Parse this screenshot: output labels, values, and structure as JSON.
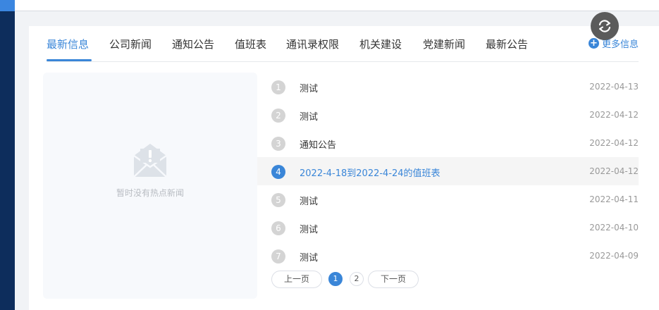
{
  "tabs": [
    {
      "label": "最新信息",
      "active": true
    },
    {
      "label": "公司新闻"
    },
    {
      "label": "通知公告"
    },
    {
      "label": "值班表"
    },
    {
      "label": "通讯录权限"
    },
    {
      "label": "机关建设"
    },
    {
      "label": "党建新闻"
    },
    {
      "label": "最新公告"
    }
  ],
  "more": {
    "icon": "plus-circle-icon",
    "label": "更多信息"
  },
  "refresh": {
    "icon": "refresh-icon"
  },
  "hot_news": {
    "icon": "empty-mail-icon",
    "empty_text": "暂时没有热点新闻"
  },
  "news": [
    {
      "num": "1",
      "title": "测试",
      "date": "2022-04-13"
    },
    {
      "num": "2",
      "title": "测试",
      "date": "2022-04-12"
    },
    {
      "num": "3",
      "title": "通知公告",
      "date": "2022-04-12"
    },
    {
      "num": "4",
      "title": "2022-4-18到2022-4-24的值班表",
      "date": "2022-04-12",
      "highlight": true
    },
    {
      "num": "5",
      "title": "测试",
      "date": "2022-04-11"
    },
    {
      "num": "6",
      "title": "测试",
      "date": "2022-04-10"
    },
    {
      "num": "7",
      "title": "测试",
      "date": "2022-04-09"
    }
  ],
  "pagination": {
    "prev": "上一页",
    "pages": [
      "1",
      "2"
    ],
    "current": "1",
    "next": "下一页"
  },
  "colors": {
    "accent": "#3a86d8",
    "sidebar": "#0d2d5c",
    "badge_inactive": "#d4d4d4"
  }
}
